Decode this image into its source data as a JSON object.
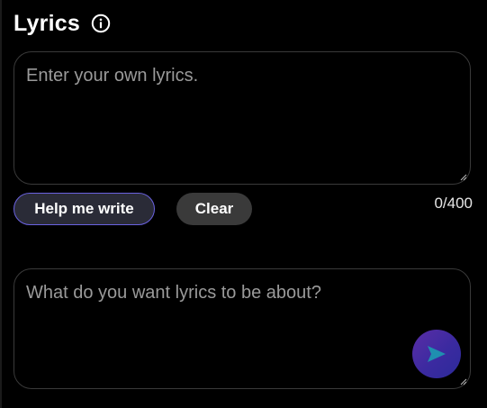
{
  "section": {
    "title": "Lyrics",
    "info_icon": "info-circle-icon"
  },
  "lyrics_input": {
    "placeholder": "Enter your own lyrics.",
    "value": "",
    "counter": "0/400"
  },
  "actions": {
    "help_label": "Help me write",
    "clear_label": "Clear"
  },
  "topic_input": {
    "placeholder": "What do you want lyrics to be about?",
    "value": "",
    "send_icon": "send-arrow-icon"
  },
  "colors": {
    "background": "#000000",
    "accent": "#6a62e0",
    "send_gradient_start": "#5a2ea6",
    "send_gradient_end": "#2c2b9a",
    "send_arrow": "#1f8fb0"
  }
}
